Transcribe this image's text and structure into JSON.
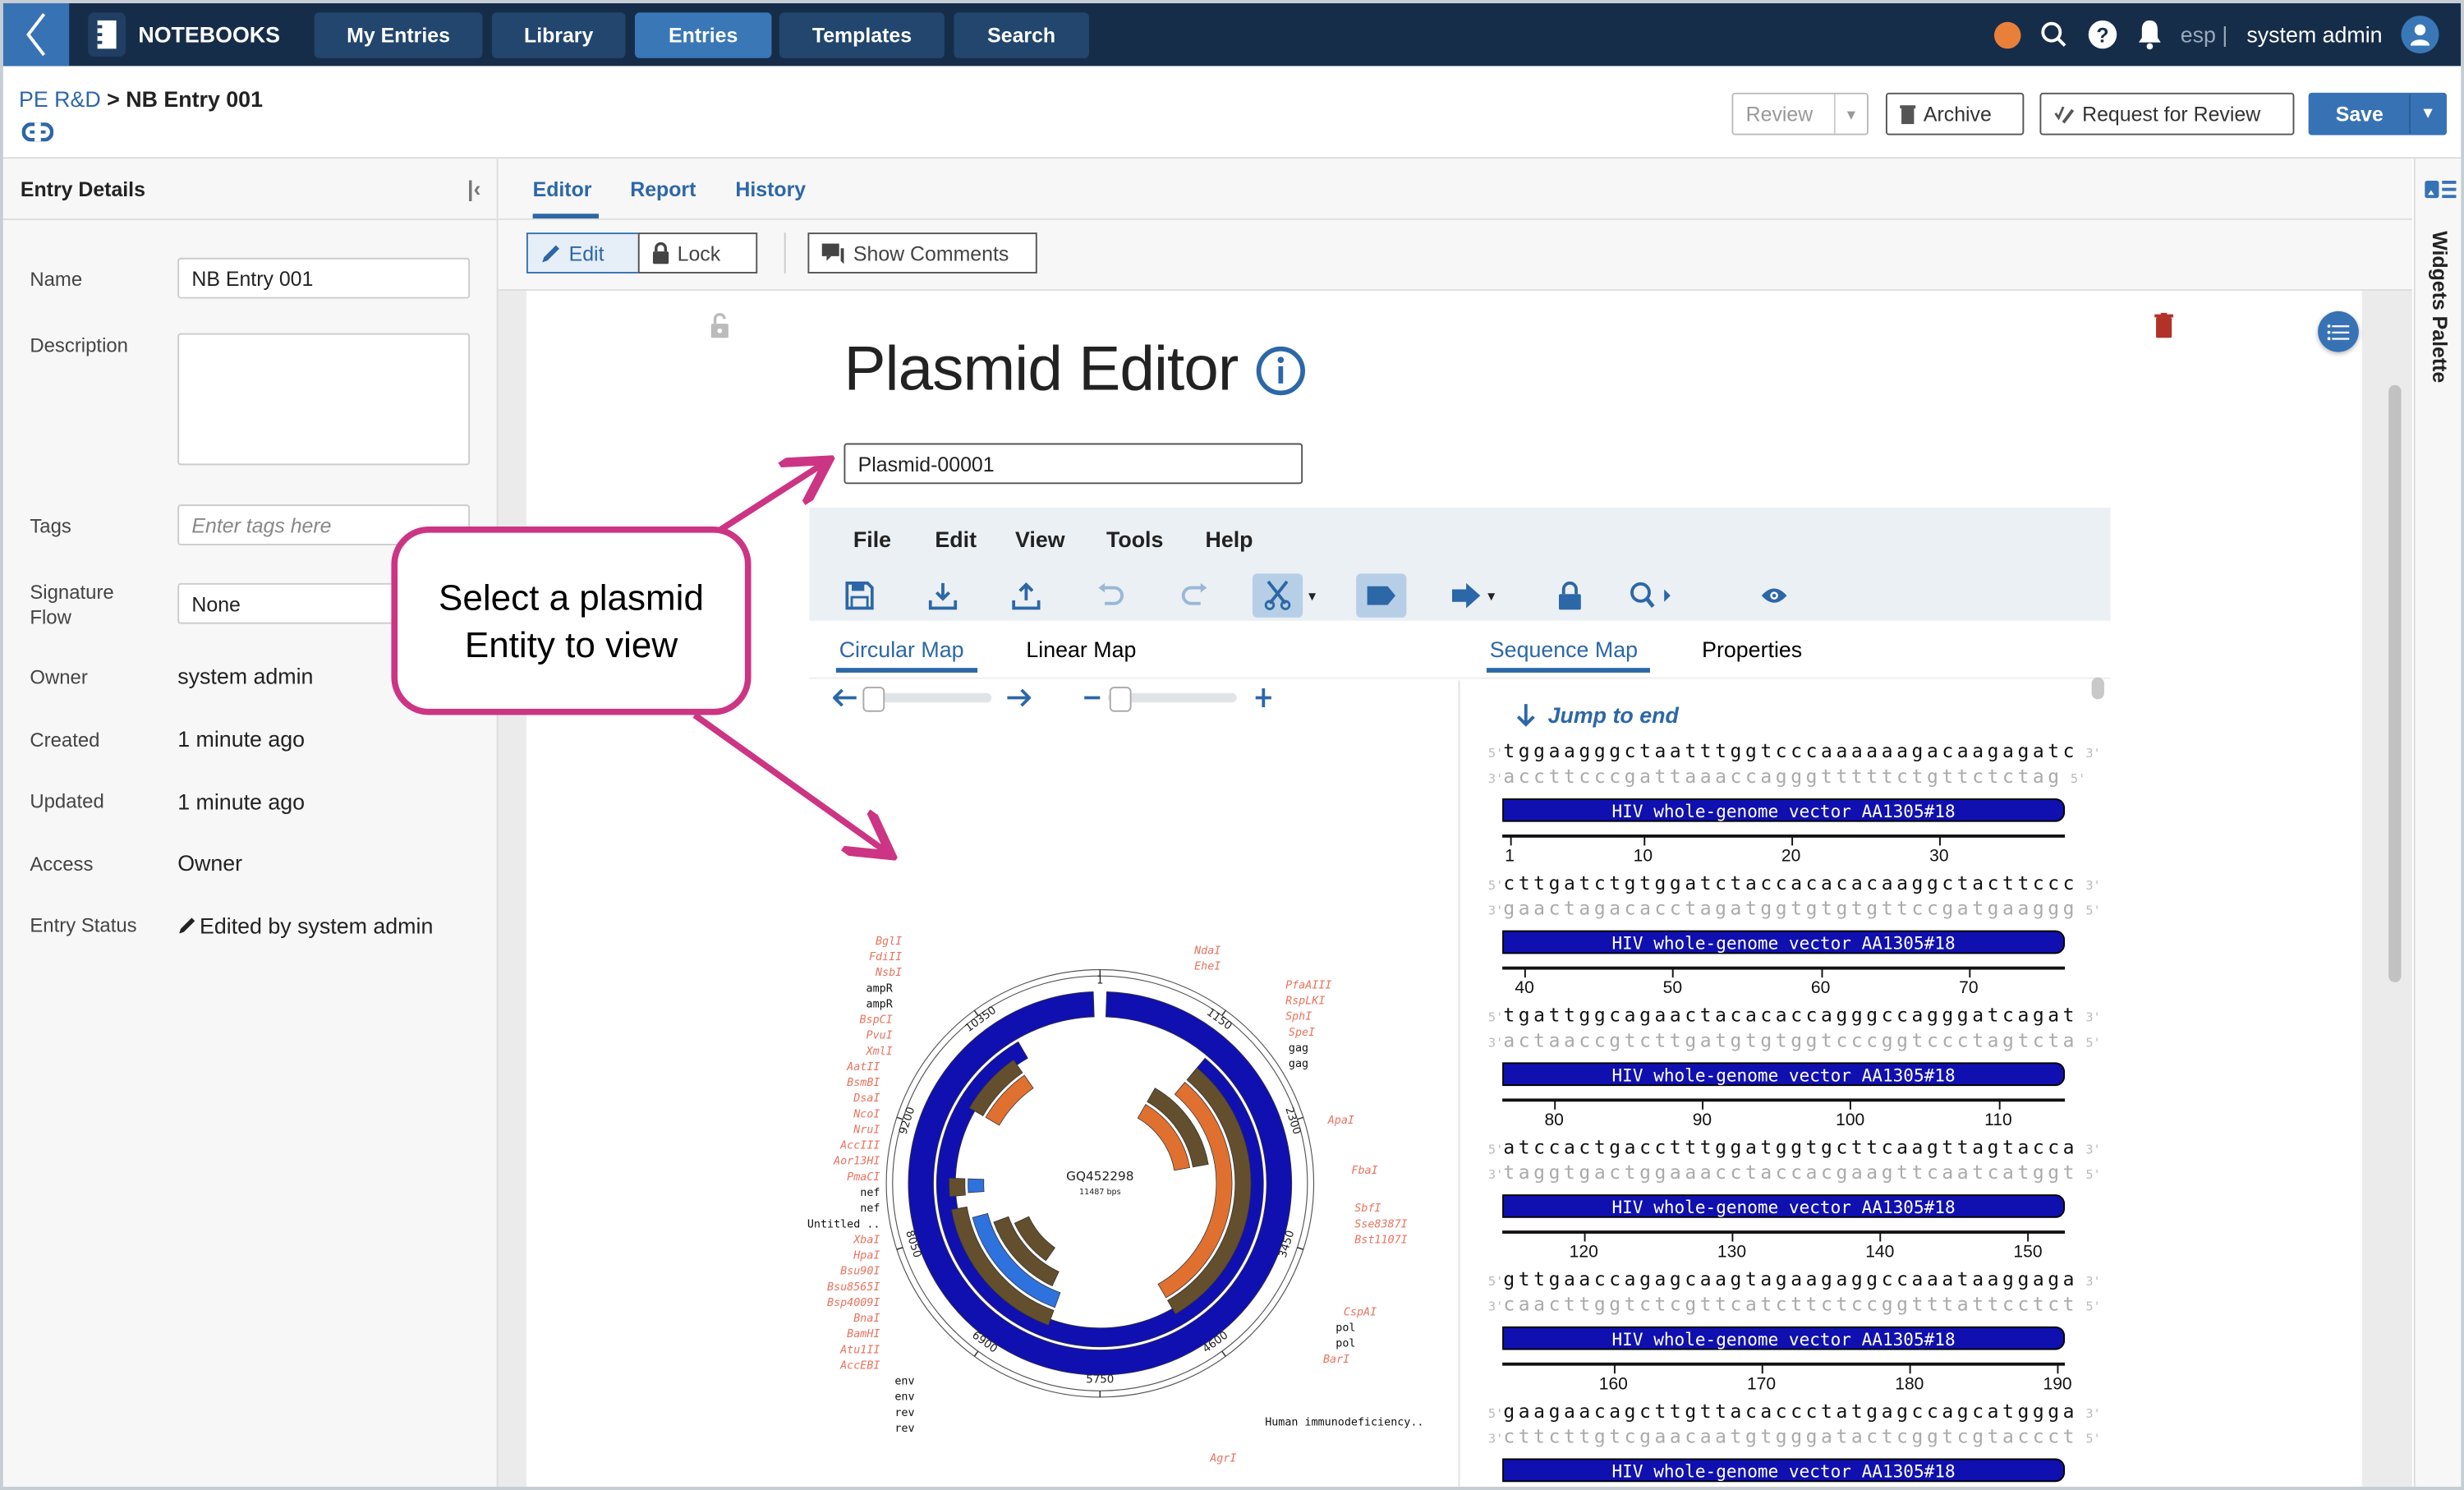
{
  "app": {
    "brand": "NOTEBOOKS",
    "nav": [
      "My Entries",
      "Library",
      "Entries",
      "Templates",
      "Search"
    ],
    "active_nav": "Entries",
    "lang": "esp |",
    "user": "system admin"
  },
  "header": {
    "breadcrumb_parent": "PE R&D",
    "breadcrumb_sep": ">",
    "breadcrumb_current": "NB Entry 001",
    "buttons": {
      "review": "Review",
      "archive": "Archive",
      "request_review": "Request for Review",
      "save": "Save"
    }
  },
  "entry_details": {
    "title": "Entry Details",
    "fields": {
      "name_label": "Name",
      "name_value": "NB Entry 001",
      "description_label": "Description",
      "description_value": "",
      "tags_label": "Tags",
      "tags_placeholder": "Enter tags here",
      "signature_label": "Signature Flow",
      "signature_value": "None",
      "owner_label": "Owner",
      "owner_value": "system admin",
      "created_label": "Created",
      "created_value": "1 minute ago",
      "updated_label": "Updated",
      "updated_value": "1 minute ago",
      "access_label": "Access",
      "access_value": "Owner",
      "status_label": "Entry Status",
      "status_value": "Edited by system admin"
    }
  },
  "main": {
    "tabs": [
      "Editor",
      "Report",
      "History"
    ],
    "active_tab": "Editor",
    "toolbar": {
      "edit": "Edit",
      "lock": "Lock",
      "show_comments": "Show Comments"
    },
    "widgets_palette": "Widgets Palette"
  },
  "plasmid": {
    "title": "Plasmid Editor",
    "entity_value": "Plasmid-00001",
    "menu": [
      "File",
      "Edit",
      "View",
      "Tools",
      "Help"
    ],
    "toolbar_icons": [
      "save-icon",
      "download-icon",
      "upload-icon",
      "undo-icon",
      "redo-icon",
      "cut-site-icon",
      "feature-icon",
      "orf-arrow-icon",
      "lock-icon",
      "search-icon",
      "eye-icon"
    ],
    "left_tabs": [
      "Circular Map",
      "Linear Map"
    ],
    "right_tabs": [
      "Sequence Map",
      "Properties"
    ],
    "jump_label": "Jump to end",
    "map": {
      "name": "GQ452298",
      "length": "11487 bps",
      "position_labels": [
        "1",
        "1150",
        "2300",
        "3450",
        "4600",
        "5750",
        "6900",
        "8050",
        "9200",
        "10350"
      ],
      "enzymes_left": [
        "BglI",
        "FdiII",
        "NsbI",
        "BspCI",
        "PvuI",
        "XmlI",
        "AatII",
        "BsmBI",
        "DsaI",
        "NcoI",
        "NruI",
        "AccIII",
        "Aor13HI",
        "PmaCI",
        "XbaI",
        "HpaI",
        "Bsu90I",
        "Bsu8565I",
        "Bsp4009I",
        "BnaI",
        "BamHI",
        "Atu1II",
        "AccEBI"
      ],
      "enzymes_right": [
        "NdaI",
        "EheI",
        "PfaAIII",
        "RspLKI",
        "SphI",
        "SpeI",
        "ApaI",
        "FbaI",
        "SbfI",
        "Sse8387I",
        "Bst1107I",
        "CspAI",
        "BarI",
        "AgrI"
      ],
      "features_left": [
        "ampR",
        "ampR",
        "nef",
        "nef",
        "Untitled ..",
        "env",
        "env",
        "rev",
        "rev"
      ],
      "features_right": [
        "gag",
        "gag",
        "pol",
        "pol",
        "Human immunodeficiency.."
      ]
    },
    "sequence_rows": [
      {
        "top": "tggaagggctaatttggtcccaaaaaagacaagagatc",
        "bottom": "accttcccgattaaaccagggtttttctgttctctag",
        "feature": "HIV whole-genome vector AA1305#18",
        "ticks": [
          "1",
          "10",
          "20",
          "30"
        ]
      },
      {
        "top": "cttgatctgtggatctaccacacacaaggctacttccc",
        "bottom": "gaactagacacctagatggtgtgtgttccgatgaaggg",
        "feature": "HIV whole-genome vector AA1305#18",
        "ticks": [
          "40",
          "50",
          "60",
          "70"
        ]
      },
      {
        "top": "tgattggcagaactacacaccagggccagggatcagat",
        "bottom": "actaaccgtcttgatgtgtggtcccggtccctagtcta",
        "feature": "HIV whole-genome vector AA1305#18",
        "ticks": [
          "80",
          "90",
          "100",
          "110"
        ]
      },
      {
        "top": "atccactgacctttggatggtgcttcaagttagtacca",
        "bottom": "taggtgactggaaacctaccacgaagttcaatcatggt",
        "feature": "HIV whole-genome vector AA1305#18",
        "ticks": [
          "120",
          "130",
          "140",
          "150"
        ]
      },
      {
        "top": "gttgaaccagagcaagtagaagaggccaaataaggaga",
        "bottom": "caacttggtctcgttcatcttctccggtttattcctct",
        "feature": "HIV whole-genome vector AA1305#18",
        "ticks": [
          "160",
          "170",
          "180",
          "190"
        ]
      },
      {
        "top": "gaagaacagcttgttacaccctatgagccagcatggga",
        "bottom": "cttcttgtcgaacaatgtgggatactcggtcgtaccct",
        "feature": "HIV whole-genome vector AA1305#18",
        "ticks": []
      }
    ]
  },
  "callout": {
    "text": "Select a plasmid Entity to view"
  },
  "colors": {
    "nav_bg": "#162d4a",
    "accent": "#3772b5",
    "callout": "#cc3583",
    "feature_blue": "#1010b0",
    "enzyme": "#e8735f"
  }
}
